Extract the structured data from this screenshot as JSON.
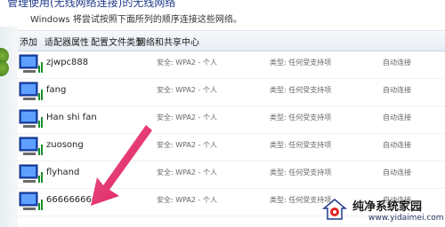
{
  "header": {
    "title_partial": "管理使用(无线网络连接)的无线网络",
    "subtitle": "Windows 将尝试按照下面所列的顺序连接这些网络。"
  },
  "toolbar": {
    "items": [
      "添加",
      "适配器属性",
      "配置文件类型",
      "网络和共享中心"
    ]
  },
  "networks": [
    {
      "name": "zjwpc888",
      "security": "安全: WPA2 - 个人",
      "type": "类型: 任何受支持项",
      "mode": "自动连接"
    },
    {
      "name": "fang",
      "security": "安全: WPA2 - 个人",
      "type": "类型: 任何受支持项",
      "mode": "自动连接"
    },
    {
      "name": "Han shi fan",
      "security": "安全: WPA2 - 个人",
      "type": "类型: 任何受支持项",
      "mode": "自动连接"
    },
    {
      "name": "zuosong",
      "security": "安全: WPA2 - 个人",
      "type": "类型: 任何受支持项",
      "mode": "自动连接"
    },
    {
      "name": "flyhand",
      "security": "安全: WPA2 - 个人",
      "type": "类型: 任何受支持项",
      "mode": "自动连接"
    },
    {
      "name": "6666666666",
      "security": "安全: WPA2 - 个人",
      "type": "类型: 任何受支持项",
      "mode": "自动连接"
    }
  ],
  "watermark": {
    "title": "纯净系统家园",
    "url": "www.yidaimei.com"
  },
  "colors": {
    "toolbar_bg": "#e7edf5",
    "arrow": "#e8236a",
    "header_text": "#1e3a8a"
  }
}
